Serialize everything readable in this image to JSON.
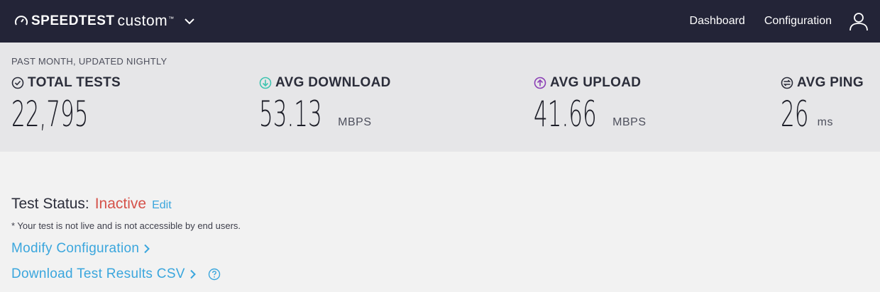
{
  "header": {
    "brand_strong": "SPEEDTEST",
    "brand_light": "custom",
    "brand_tm": "™",
    "nav": [
      {
        "label": "Dashboard"
      },
      {
        "label": "Configuration"
      }
    ]
  },
  "stats": {
    "period": "PAST MONTH, UPDATED NIGHTLY",
    "metrics": [
      {
        "label": "TOTAL TESTS",
        "value": "22,795",
        "unit": ""
      },
      {
        "label": "AVG DOWNLOAD",
        "value": "53.13",
        "unit": "MBPS"
      },
      {
        "label": "AVG UPLOAD",
        "value": "41.66",
        "unit": "MBPS"
      },
      {
        "label": "AVG PING",
        "value": "26",
        "unit": "ms"
      }
    ],
    "colors": {
      "download": "#3ec4b0",
      "upload": "#8b3fb5",
      "ink": "#2b2d3a"
    }
  },
  "status": {
    "label": "Test Status:",
    "value": "Inactive",
    "edit": "Edit",
    "note": "* Your test is not live and is not accessible by end users.",
    "value_color": "#d5524a"
  },
  "links": {
    "modify": "Modify Configuration",
    "download_csv": "Download Test Results CSV",
    "color": "#3aa6dd"
  }
}
